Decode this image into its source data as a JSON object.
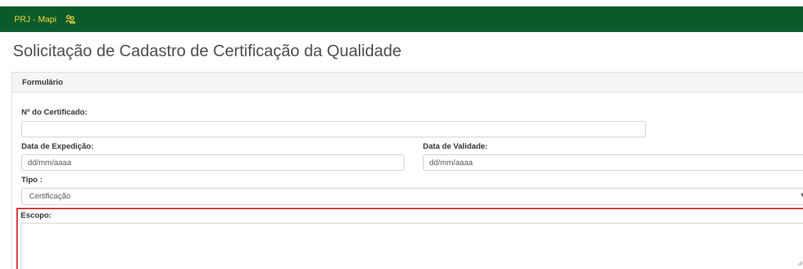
{
  "navbar": {
    "brand": "PRJ - Mapi",
    "user_icon": "users-icon",
    "colors": {
      "background": "#0b5a2a",
      "brand_text": "#f5d53a"
    }
  },
  "page": {
    "title": "Solicitação de Cadastro de Certificação da Qualidade"
  },
  "form": {
    "heading": "Formulário",
    "certificate_number": {
      "label": "Nº do Certificado:",
      "value": "",
      "placeholder": ""
    },
    "issue_date": {
      "label": "Data de Expedição:",
      "value": "",
      "placeholder": "dd/mm/aaaa"
    },
    "expiry_date": {
      "label": "Data de Validade:",
      "value": "",
      "placeholder": "dd/mm/aaaa"
    },
    "type": {
      "label": "Tipo :",
      "selected": "Certificação",
      "caret_icon": "caret-down-icon"
    },
    "scope": {
      "label": "Escopo:",
      "value": "",
      "highlight_color": "#d9262c"
    }
  }
}
